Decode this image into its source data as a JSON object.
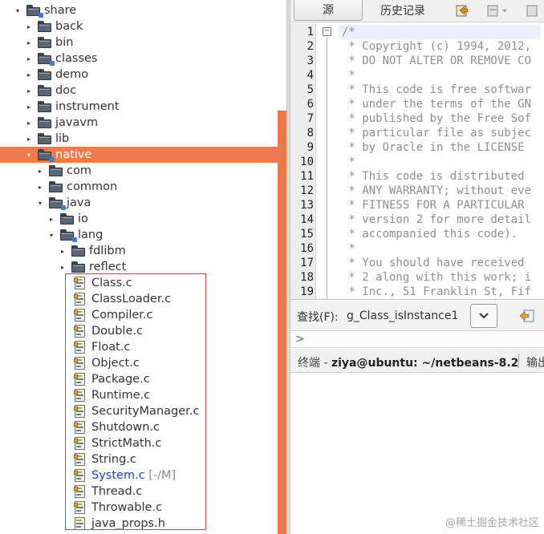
{
  "tree": {
    "rows": [
      {
        "label": "share",
        "kind": "pkg",
        "open": true,
        "indent": 0
      },
      {
        "label": "back",
        "kind": "folder",
        "open": false,
        "indent": 1
      },
      {
        "label": "bin",
        "kind": "folder",
        "open": false,
        "indent": 1
      },
      {
        "label": "classes",
        "kind": "pkg",
        "open": false,
        "indent": 1
      },
      {
        "label": "demo",
        "kind": "folder",
        "open": false,
        "indent": 1
      },
      {
        "label": "doc",
        "kind": "folder",
        "open": false,
        "indent": 1
      },
      {
        "label": "instrument",
        "kind": "folder",
        "open": false,
        "indent": 1
      },
      {
        "label": "javavm",
        "kind": "folder",
        "open": false,
        "indent": 1
      },
      {
        "label": "lib",
        "kind": "folder",
        "open": false,
        "indent": 1
      },
      {
        "label": "native",
        "kind": "pkg",
        "open": true,
        "indent": 1,
        "selected": true
      },
      {
        "label": "com",
        "kind": "folder",
        "open": false,
        "indent": 2
      },
      {
        "label": "common",
        "kind": "folder",
        "open": false,
        "indent": 2
      },
      {
        "label": "java",
        "kind": "pkg",
        "open": true,
        "indent": 2
      },
      {
        "label": "io",
        "kind": "folder",
        "open": false,
        "indent": 3
      },
      {
        "label": "lang",
        "kind": "pkg",
        "open": true,
        "indent": 3
      },
      {
        "label": "fdlibm",
        "kind": "folder",
        "open": false,
        "indent": 4
      },
      {
        "label": "reflect",
        "kind": "folder",
        "open": false,
        "indent": 4
      }
    ],
    "files": [
      {
        "label": "Class.c"
      },
      {
        "label": "ClassLoader.c"
      },
      {
        "label": "Compiler.c"
      },
      {
        "label": "Double.c"
      },
      {
        "label": "Float.c"
      },
      {
        "label": "Object.c"
      },
      {
        "label": "Package.c"
      },
      {
        "label": "Runtime.c"
      },
      {
        "label": "SecurityManager.c"
      },
      {
        "label": "Shutdown.c"
      },
      {
        "label": "StrictMath.c"
      },
      {
        "label": "String.c"
      },
      {
        "label": "System.c",
        "modified": true,
        "suffix": " [-/M]"
      },
      {
        "label": "Thread.c"
      },
      {
        "label": "Throwable.c"
      },
      {
        "label": "java_props.h",
        "plain": true
      }
    ]
  },
  "editor": {
    "tabs": {
      "source": "源",
      "history": "历史记录"
    },
    "lines": [
      {
        "n": "1",
        "text": "/*"
      },
      {
        "n": "2",
        "text": " * Copyright (c) 1994, 2012,"
      },
      {
        "n": "3",
        "text": " * DO NOT ALTER OR REMOVE CO"
      },
      {
        "n": "4",
        "text": " *"
      },
      {
        "n": "5",
        "text": " * This code is free softwar"
      },
      {
        "n": "6",
        "text": " * under the terms of the GN"
      },
      {
        "n": "7",
        "text": " * published by the Free Sof"
      },
      {
        "n": "8",
        "text": " * particular file as subjec"
      },
      {
        "n": "9",
        "text": " * by Oracle in the LICENSE"
      },
      {
        "n": "10",
        "text": " *"
      },
      {
        "n": "11",
        "text": " * This code is distributed"
      },
      {
        "n": "12",
        "text": " * ANY WARRANTY; without eve"
      },
      {
        "n": "13",
        "text": " * FITNESS FOR A PARTICULAR"
      },
      {
        "n": "14",
        "text": " * version 2 for more detail"
      },
      {
        "n": "15",
        "text": " * accompanied this code)."
      },
      {
        "n": "16",
        "text": " *"
      },
      {
        "n": "17",
        "text": " * You should have received"
      },
      {
        "n": "18",
        "text": " * 2 along with this work; i"
      },
      {
        "n": "19",
        "text": " * Inc., 51 Franklin St, Fif"
      }
    ]
  },
  "find": {
    "label": "查找(F):",
    "value": "g_Class_isInstance1"
  },
  "terminal": {
    "prefix": "终端 - ",
    "title": "ziya@ubuntu: ~/netbeans-8.2",
    "output_tab": "输出"
  },
  "watermark": "@稀土掘金技术社区"
}
